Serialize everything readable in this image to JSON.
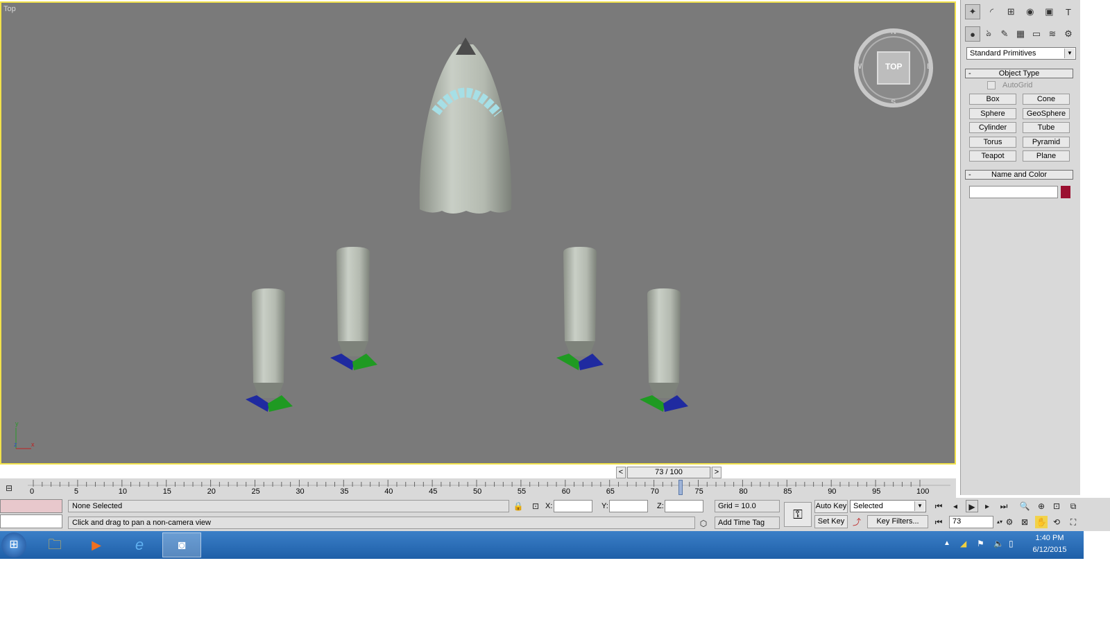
{
  "viewport": {
    "label": "Top",
    "viewcube_label": "TOP",
    "compass": {
      "n": "N",
      "s": "S",
      "e": "E",
      "w": "W"
    },
    "axis": {
      "y": "y",
      "x": "x",
      "z": "z"
    }
  },
  "command_panel": {
    "dropdown": "Standard Primitives",
    "object_type": {
      "title": "Object Type",
      "autogrid": "AutoGrid",
      "buttons": [
        "Box",
        "Cone",
        "Sphere",
        "GeoSphere",
        "Cylinder",
        "Tube",
        "Torus",
        "Pyramid",
        "Teapot",
        "Plane"
      ]
    },
    "name_color": {
      "title": "Name and Color",
      "swatch": "#9b1030"
    }
  },
  "timeline": {
    "position": "73 / 100",
    "current": 73,
    "max": 100,
    "ticks": [
      "0",
      "5",
      "10",
      "15",
      "20",
      "25",
      "30",
      "35",
      "40",
      "45",
      "50",
      "55",
      "60",
      "65",
      "70",
      "75",
      "80",
      "85",
      "90",
      "95",
      "100"
    ]
  },
  "status": {
    "selection": "None Selected",
    "prompt": "Click and drag to pan a non-camera view",
    "x_label": "X:",
    "y_label": "Y:",
    "z_label": "Z:",
    "grid": "Grid = 10.0",
    "add_time_tag": "Add Time Tag",
    "auto_key": "Auto Key",
    "set_key": "Set Key",
    "key_mode": "Selected",
    "key_filters": "Key Filters...",
    "frame": "73"
  },
  "taskbar": {
    "time": "1:40 PM",
    "date": "6/12/2015"
  }
}
